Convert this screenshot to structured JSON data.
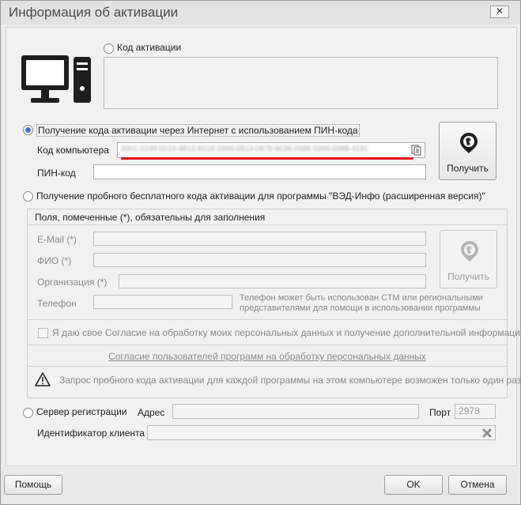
{
  "window": {
    "title": "Информация об активации",
    "close": "✕"
  },
  "activation_code": {
    "label": "Код активации"
  },
  "internet": {
    "label": "Получение кода активации через Интернет с использованием ПИН-кода",
    "computer_code_label": "Код компьютера",
    "computer_code_value": "0001-2239-5515-9812-8318-2399-0813-0878-9638-0588-5399-0988-4191",
    "pin_label": "ПИН-код",
    "get_button": "Получить"
  },
  "trial": {
    "label": "Получение пробного бесплатного кода активации для программы \"ВЭД-Инфо (расширенная версия)\"",
    "required_note": "Поля, помеченные (*), обязательны для заполнения",
    "email_label": "E-Mail (*)",
    "fio_label": "ФИО (*)",
    "org_label": "Организация (*)",
    "phone_label": "Телефон",
    "phone_note": "Телефон может быть использован СТМ или региональными представителями для помощи в использовании программы",
    "get_button": "Получить",
    "consent_label": "Я даю свое Согласие на обработку моих персональных данных и получение дополнительной информации",
    "consent_link": "Согласие пользователей программ на обработку персональных данных",
    "warning": "Запрос пробного кода активации для каждой программы на этом компьютере возможен только один раз"
  },
  "server": {
    "label": "Сервер регистрации",
    "address_label": "Адрес",
    "port_label": "Порт",
    "port_value": "2978",
    "client_id_label": "Идентификатор клиента"
  },
  "footer": {
    "help": "Помощь",
    "ok": "OK",
    "cancel": "Отмена"
  }
}
